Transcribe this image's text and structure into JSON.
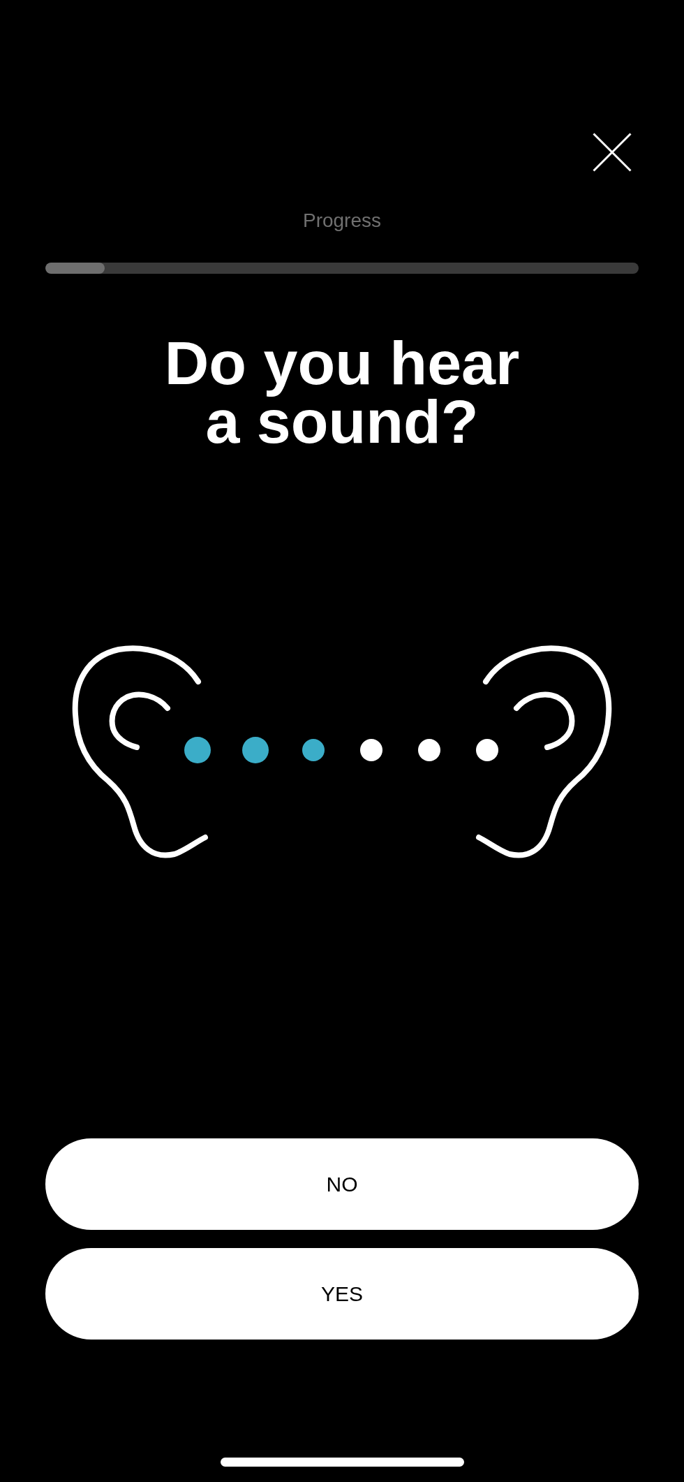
{
  "progress": {
    "label": "Progress",
    "level": 0.1
  },
  "question": "Do you hear a sound?",
  "illustration": {
    "dots": [
      {
        "color": "#3badc8",
        "kind": "large"
      },
      {
        "color": "#3badc8",
        "kind": "large"
      },
      {
        "color": "#3badc8",
        "kind": "small"
      },
      {
        "color": "#ffffff",
        "kind": "small"
      },
      {
        "color": "#ffffff",
        "kind": "small"
      },
      {
        "color": "#ffffff",
        "kind": "small"
      }
    ]
  },
  "buttons": [
    {
      "label": "NO"
    },
    {
      "label": "YES"
    }
  ]
}
